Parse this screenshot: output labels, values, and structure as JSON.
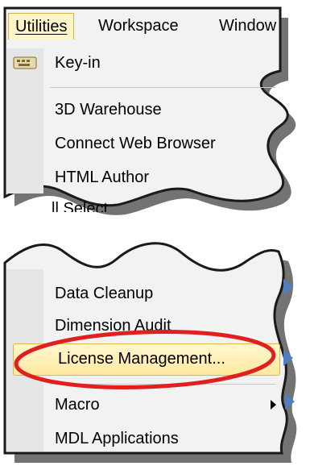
{
  "menubar": {
    "utilities": "Utilities",
    "workspace": "Workspace",
    "window": "Window"
  },
  "menu": {
    "keyin": "Key-in",
    "warehouse": "3D Warehouse",
    "web_browser": "Connect Web Browser",
    "html_author": "HTML Author",
    "select_partial": "ll Select",
    "data_cleanup": "Data Cleanup",
    "dimension_audit": "Dimension Audit",
    "license": "License Management...",
    "macro": "Macro",
    "mdl": "MDL Applications"
  },
  "colors": {
    "highlight_fill": "#fff0b8",
    "highlight_border": "#e0b84a",
    "annotation_ellipse": "#e02020",
    "panel_bg": "#f2f2f2",
    "submenu_chevron": "#4f7fc2"
  },
  "icons": {
    "keyin": "keyboard-icon",
    "submenu": "submenu-arrow-icon",
    "annotation": "red-ellipse"
  }
}
